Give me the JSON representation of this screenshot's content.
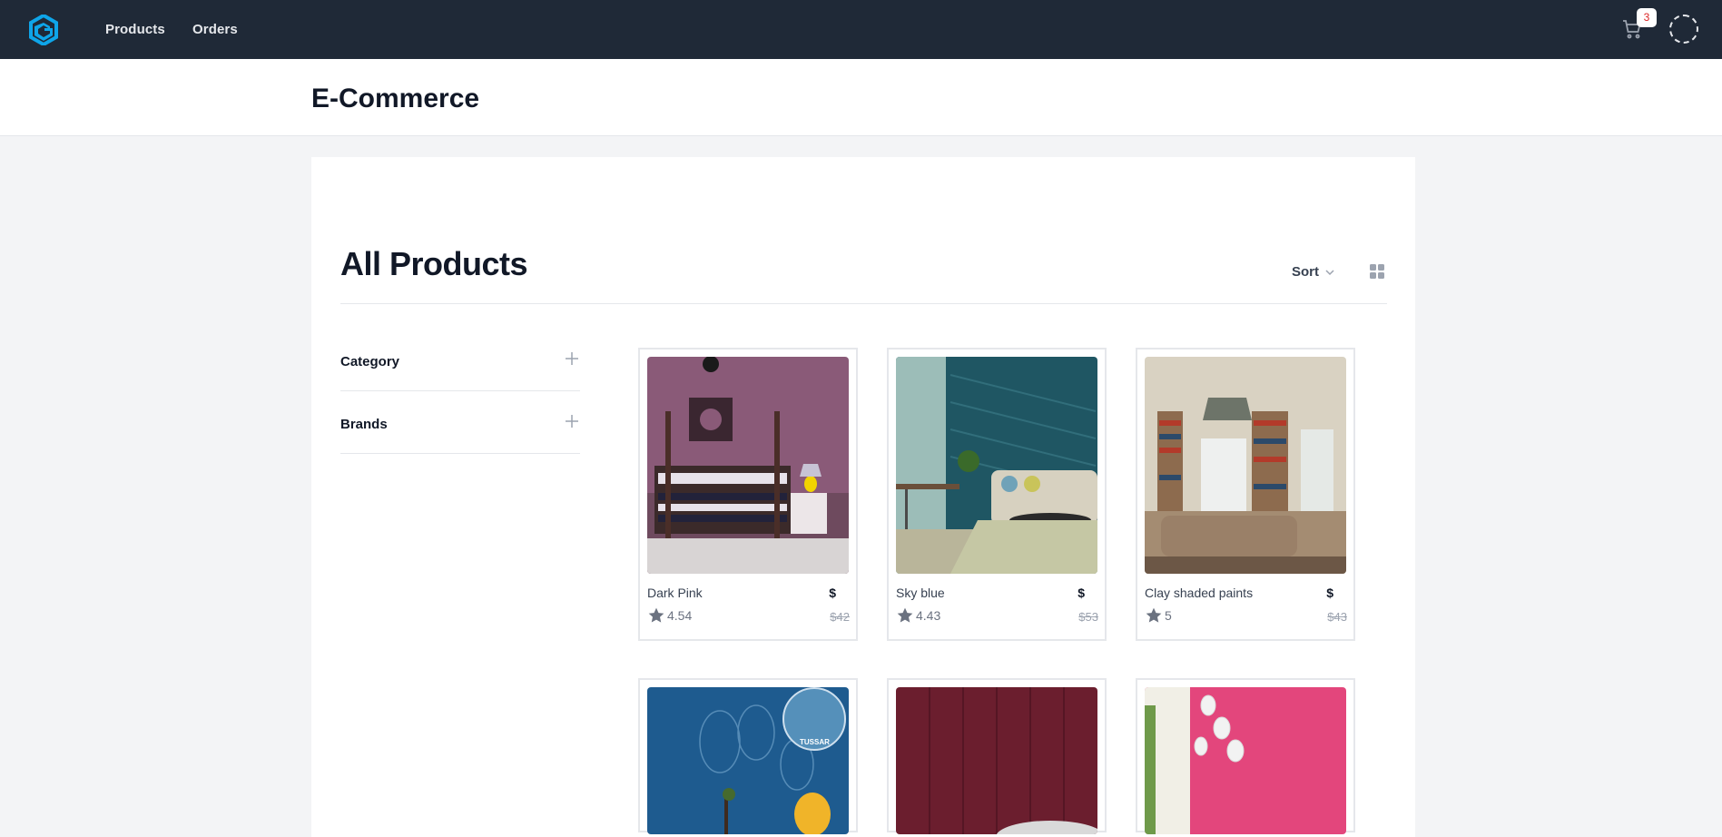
{
  "nav": {
    "products": "Products",
    "orders": "Orders",
    "cart_count": "3"
  },
  "header": {
    "title": "E-Commerce"
  },
  "main": {
    "title": "All Products",
    "sort_label": "Sort",
    "filters": [
      {
        "label": "Category"
      },
      {
        "label": "Brands"
      }
    ]
  },
  "products": [
    {
      "name": "Dark Pink",
      "currency": "$",
      "old_price": "$42",
      "rating": "4.54"
    },
    {
      "name": "Sky blue",
      "currency": "$",
      "old_price": "$53",
      "rating": "4.43"
    },
    {
      "name": "Clay shaded paints",
      "currency": "$",
      "old_price": "$43",
      "rating": "5"
    },
    {
      "name": "",
      "badge": "TUSSAR"
    },
    {
      "name": ""
    },
    {
      "name": ""
    }
  ],
  "colors": {
    "nav_bg": "#1f2937",
    "accent": "#0ea5e9",
    "badge_text": "#dc2626"
  }
}
